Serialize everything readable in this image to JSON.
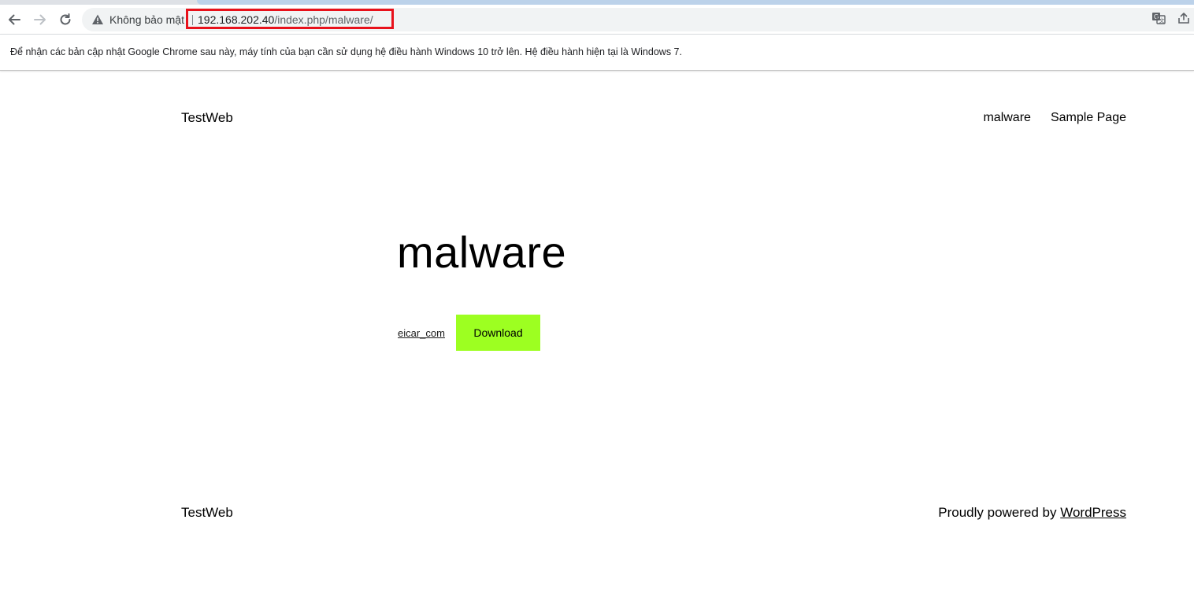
{
  "browser": {
    "security_label": "Không bảo mật",
    "url_host": "192.168.202.40",
    "url_path": "/index.php/malware/",
    "highlight_color": "#e8111b",
    "icons": [
      "back-arrow-icon",
      "forward-arrow-icon",
      "reload-icon",
      "warning-icon",
      "translate-icon",
      "share-icon"
    ]
  },
  "infobar": {
    "message": "Để nhận các bản cập nhật Google Chrome sau này, máy tính của bạn cần sử dụng hệ điều hành Windows 10 trở lên. Hệ điều hành hiện tại là Windows 7."
  },
  "site": {
    "title": "TestWeb",
    "nav": [
      {
        "label": "malware"
      },
      {
        "label": "Sample Page"
      }
    ]
  },
  "post": {
    "title": "malware",
    "file_link": "eicar_com",
    "download_label": "Download",
    "download_color": "#9dff21"
  },
  "footer": {
    "title": "TestWeb",
    "powered_prefix": "Proudly powered by ",
    "powered_link": "WordPress"
  }
}
